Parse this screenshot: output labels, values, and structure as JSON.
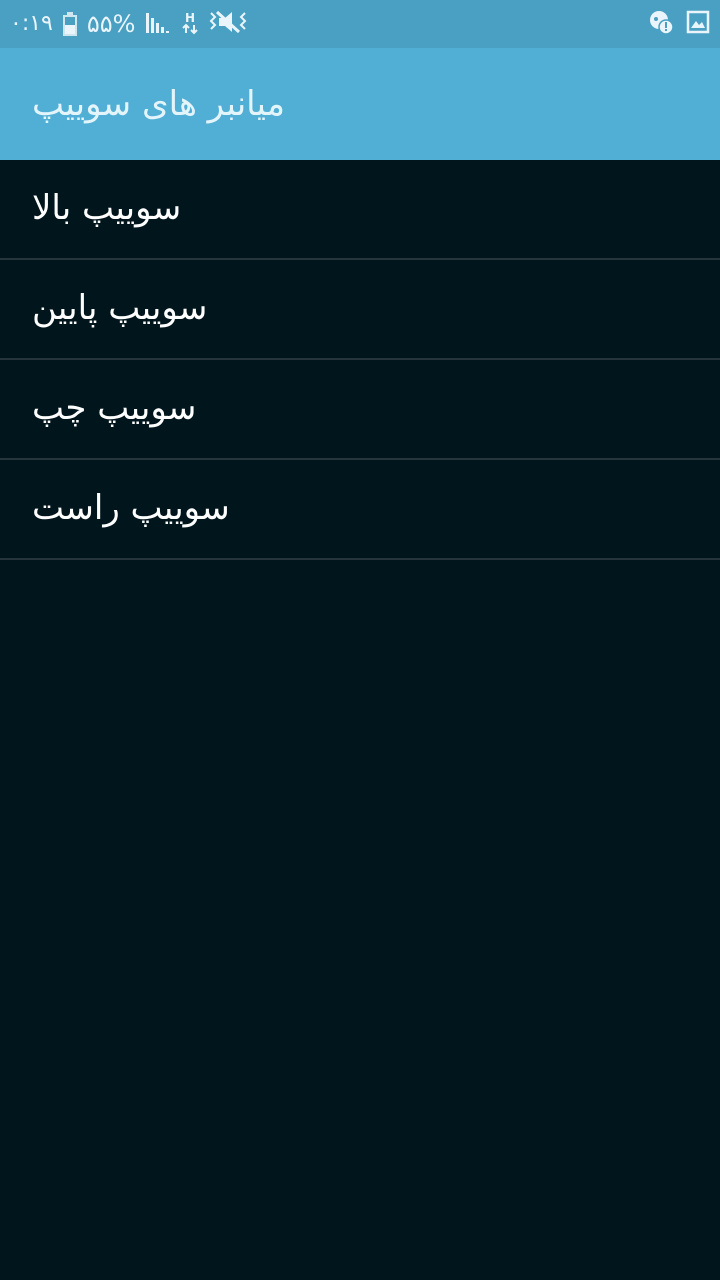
{
  "status_bar": {
    "time": "۰:۱۹",
    "battery_percent": "۵۵%",
    "battery_level": 0.55,
    "network_type": "H",
    "icons_left": [
      "battery-icon",
      "signal-icon",
      "network-h-icon",
      "mute-icon"
    ],
    "icons_right": [
      "notification-alert-icon",
      "gallery-icon"
    ]
  },
  "app_bar": {
    "title": "میانبر های سوییپ"
  },
  "list": {
    "items": [
      {
        "label": "سوییپ بالا"
      },
      {
        "label": "سوییپ پایین"
      },
      {
        "label": "سوییپ چپ"
      },
      {
        "label": "سوییپ راست"
      }
    ]
  },
  "colors": {
    "status_bar": "#4aa0c2",
    "app_bar": "#51afd5",
    "background": "#01151d",
    "divider": "#26353b",
    "text": "#ffffff"
  }
}
